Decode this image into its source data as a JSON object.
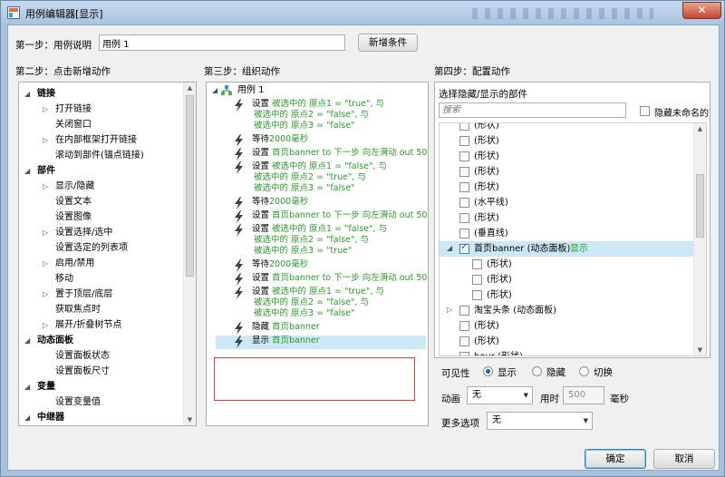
{
  "window": {
    "title": "用例编辑器[显示]",
    "close_glyph": "✕"
  },
  "step1": {
    "label": "第一步：用例说明",
    "value": "用例 1",
    "add_condition": "新增条件"
  },
  "step2": {
    "label": "第二步：点击新增动作",
    "items": [
      {
        "text": "链接",
        "bold": true,
        "toggle": "◢"
      },
      {
        "text": "打开链接",
        "toggle": "▷"
      },
      {
        "text": "关闭窗口",
        "toggle": ""
      },
      {
        "text": "在内部框架打开链接",
        "toggle": "▷"
      },
      {
        "text": "滚动到部件(锚点链接)",
        "toggle": ""
      },
      {
        "text": "部件",
        "bold": true,
        "toggle": "◢"
      },
      {
        "text": "显示/隐藏",
        "toggle": "▷"
      },
      {
        "text": "设置文本",
        "toggle": ""
      },
      {
        "text": "设置图像",
        "toggle": ""
      },
      {
        "text": "设置选择/选中",
        "toggle": "▷"
      },
      {
        "text": "设置选定的列表项",
        "toggle": ""
      },
      {
        "text": "启用/禁用",
        "toggle": "▷"
      },
      {
        "text": "移动",
        "toggle": ""
      },
      {
        "text": "置于顶层/底层",
        "toggle": "▷"
      },
      {
        "text": "获取焦点时",
        "toggle": ""
      },
      {
        "text": "展开/折叠树节点",
        "toggle": "▷"
      },
      {
        "text": "动态面板",
        "bold": true,
        "toggle": "◢"
      },
      {
        "text": "设置面板状态",
        "toggle": ""
      },
      {
        "text": "设置面板尺寸",
        "toggle": ""
      },
      {
        "text": "变量",
        "bold": true,
        "toggle": "◢"
      },
      {
        "text": "设置变量值",
        "toggle": ""
      },
      {
        "text": "中继器",
        "bold": true,
        "toggle": "◢"
      }
    ]
  },
  "step3": {
    "label": "第三步：组织动作",
    "root": "用例 1",
    "actions": [
      {
        "lines": [
          [
            [
              "设置 ",
              "k"
            ],
            [
              "被选中的 原点1 = \"true\", 与",
              "g"
            ]
          ],
          [
            [
              "被选中的 原点2 = \"false\", 与",
              "g"
            ]
          ],
          [
            [
              "被选中的 原点3 = \"false\"",
              "g"
            ]
          ]
        ]
      },
      {
        "lines": [
          [
            [
              "等待",
              "k"
            ],
            [
              "2000毫秒",
              "g"
            ]
          ]
        ]
      },
      {
        "lines": [
          [
            [
              "设置 ",
              "k"
            ],
            [
              "首页banner to 下一步 向左滑动 out 50",
              "g"
            ]
          ]
        ]
      },
      {
        "lines": [
          [
            [
              "设置 ",
              "k"
            ],
            [
              "被选中的 原点1 = \"false\", 与",
              "g"
            ]
          ],
          [
            [
              "被选中的 原点2 = \"true\", 与",
              "g"
            ]
          ],
          [
            [
              "被选中的 原点3 = \"false\"",
              "g"
            ]
          ]
        ]
      },
      {
        "lines": [
          [
            [
              "等待",
              "k"
            ],
            [
              "2000毫秒",
              "g"
            ]
          ]
        ]
      },
      {
        "lines": [
          [
            [
              "设置 ",
              "k"
            ],
            [
              "首页banner to 下一步 向左滑动 out 50",
              "g"
            ]
          ]
        ]
      },
      {
        "lines": [
          [
            [
              "设置 ",
              "k"
            ],
            [
              "被选中的 原点1 = \"false\", 与",
              "g"
            ]
          ],
          [
            [
              "被选中的 原点2 = \"false\", 与",
              "g"
            ]
          ],
          [
            [
              "被选中的 原点3 = \"true\"",
              "g"
            ]
          ]
        ]
      },
      {
        "lines": [
          [
            [
              "等待",
              "k"
            ],
            [
              "2000毫秒",
              "g"
            ]
          ]
        ]
      },
      {
        "lines": [
          [
            [
              "设置 ",
              "k"
            ],
            [
              "首页banner to 下一步 向左滑动 out 50",
              "g"
            ]
          ]
        ]
      },
      {
        "lines": [
          [
            [
              "设置 ",
              "k"
            ],
            [
              "被选中的 原点1 = \"true\", 与",
              "g"
            ]
          ],
          [
            [
              "被选中的 原点2 = \"false\", 与",
              "g"
            ]
          ],
          [
            [
              "被选中的 原点3 = \"false\"",
              "g"
            ]
          ]
        ]
      },
      {
        "lines": [
          [
            [
              "隐藏 ",
              "k"
            ],
            [
              "首页banner",
              "g"
            ]
          ]
        ]
      },
      {
        "lines": [
          [
            [
              "显示 ",
              "k"
            ],
            [
              "首页banner",
              "g"
            ]
          ]
        ],
        "selected": true
      }
    ]
  },
  "step4": {
    "label": "第四步：配置动作",
    "sub_label": "选择隐藏/显示的部件",
    "search_placeholder": "搜索",
    "hide_unnamed": "隐藏未命名的",
    "widgets": [
      {
        "text": "(形状)",
        "indent": 1
      },
      {
        "text": "(形状)",
        "indent": 1
      },
      {
        "text": "(形状)",
        "indent": 1
      },
      {
        "text": "(形状)",
        "indent": 1
      },
      {
        "text": "(形状)",
        "indent": 1
      },
      {
        "text": "(水平线)",
        "indent": 1
      },
      {
        "text": "(形状)",
        "indent": 1
      },
      {
        "text": "(垂直线)",
        "indent": 1
      },
      {
        "text": "首页banner (动态面板)",
        "indent": 0,
        "checked": true,
        "toggle": "◢",
        "status": "显示",
        "highlight": true
      },
      {
        "text": "(形状)",
        "indent": 2
      },
      {
        "text": "(形状)",
        "indent": 2
      },
      {
        "text": "(形状)",
        "indent": 2
      },
      {
        "text": "淘宝头条 (动态面板)",
        "indent": 0,
        "toggle": "▷"
      },
      {
        "text": "(形状)",
        "indent": 1
      },
      {
        "text": "(形状)",
        "indent": 1
      },
      {
        "text": "hour (形状)",
        "indent": 1
      }
    ],
    "visibility_label": "可见性",
    "vis_options": [
      "显示",
      "隐藏",
      "切换"
    ],
    "vis_selected": 0,
    "animation_label": "动画",
    "animation_value": "无",
    "time_label": "用时",
    "time_value": "500",
    "time_unit": "毫秒",
    "more_label": "更多选项",
    "more_value": "无"
  },
  "footer": {
    "ok": "确定",
    "cancel": "取消"
  },
  "colors": {
    "accent": "#2a9b2a",
    "selection": "#cce8f6",
    "highlight_box": "#e03c3c"
  }
}
